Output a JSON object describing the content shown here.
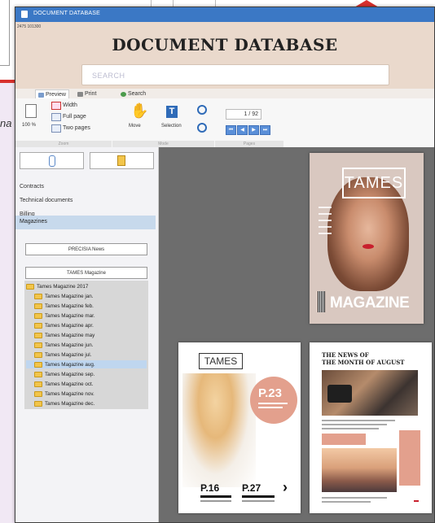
{
  "background": {
    "side_text": "na"
  },
  "window": {
    "title": "DOCUMENT DATABASE",
    "id_line": "2475 101300",
    "app_title": "DOCUMENT DATABASE",
    "search_placeholder": "SEARCH"
  },
  "tabs": [
    {
      "label": "Preview",
      "icon": "eye-icon"
    },
    {
      "label": "Print",
      "icon": "printer-icon"
    },
    {
      "label": "Search",
      "icon": "search-icon"
    }
  ],
  "ribbon": {
    "zoom_group": {
      "percent": "100 %",
      "width": "Width",
      "full_page": "Full page",
      "two_pages": "Two pages",
      "label": "Zoom"
    },
    "mode_group": {
      "move": "Move",
      "selection": "Selection",
      "label": "Mode"
    },
    "pages_group": {
      "page_indicator": "1 / 92",
      "label": "Pages"
    }
  },
  "sidebar": {
    "categories": [
      "Contracts",
      "Technical documents",
      "Billing",
      "Magazines"
    ],
    "selected_category": "Magazines",
    "magazine_buttons": [
      "PRECISIA News",
      "TAMES Magazine"
    ],
    "tree": {
      "root": "Tames Magazine 2017",
      "items": [
        "Tames Magazine jan.",
        "Tames Magazine feb.",
        "Tames Magazine mar.",
        "Tames Magazine apr.",
        "Tames Magazine may",
        "Tames Magazine jun.",
        "Tames Magazine jul.",
        "Tames Magazine aug.",
        "Tames Magazine sep.",
        "Tames Magazine oct.",
        "Tames Magazine nov.",
        "Tames Magazine dec."
      ],
      "selected": "Tames Magazine aug."
    }
  },
  "preview": {
    "cover": {
      "brand": "TAMES",
      "word": "MAGAZINE"
    },
    "page2": {
      "brand": "TAMES",
      "badge": "P.23",
      "left_page": "P.16",
      "right_page": "P.27",
      "arrow": "›"
    },
    "page3": {
      "headline_line1": "THE NEWS OF",
      "headline_line2": "THE MONTH OF AUGUST"
    }
  },
  "colors": {
    "titlebar": "#3b78c5",
    "header_bg": "#ead9cc",
    "accent_pink": "#e3a08d",
    "brand_red": "#d8302d"
  }
}
